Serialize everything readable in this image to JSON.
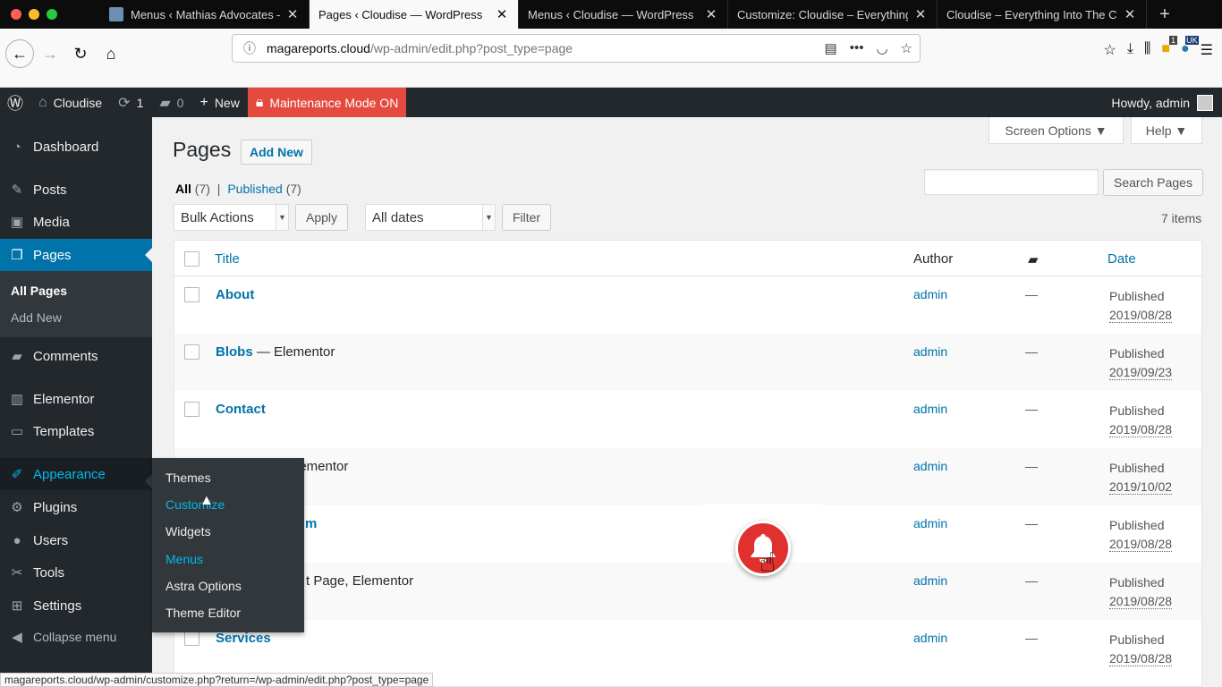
{
  "browser": {
    "tabs": [
      {
        "label": "Menus ‹ Mathias Advocates —",
        "active": false
      },
      {
        "label": "Pages ‹ Cloudise — WordPress",
        "active": true
      },
      {
        "label": "Menus ‹ Cloudise — WordPress",
        "active": false
      },
      {
        "label": "Customize: Cloudise – Everything I",
        "active": false
      },
      {
        "label": "Cloudise – Everything Into The Clo",
        "active": false
      }
    ],
    "url_host": "magareports.cloud",
    "url_path": "/wp-admin/edit.php?post_type=page",
    "badge_count": "1",
    "flag_badge": "UK",
    "status_url": "magareports.cloud/wp-admin/customize.php?return=/wp-admin/edit.php?post_type=page"
  },
  "adminbar": {
    "site_name": "Cloudise",
    "updates": "1",
    "comments": "0",
    "new_label": "New",
    "maintenance": "Maintenance Mode ON",
    "howdy": "Howdy, admin"
  },
  "sidebar": {
    "items": [
      {
        "label": "Dashboard",
        "icon": "dashboard-icon"
      },
      {
        "label": "Posts",
        "icon": "pin-icon"
      },
      {
        "label": "Media",
        "icon": "media-icon"
      },
      {
        "label": "Pages",
        "icon": "pages-icon"
      },
      {
        "label": "Comments",
        "icon": "comment-icon"
      },
      {
        "label": "Elementor",
        "icon": "elementor-icon"
      },
      {
        "label": "Templates",
        "icon": "folder-icon"
      },
      {
        "label": "Appearance",
        "icon": "brush-icon"
      },
      {
        "label": "Plugins",
        "icon": "plugin-icon"
      },
      {
        "label": "Users",
        "icon": "user-icon"
      },
      {
        "label": "Tools",
        "icon": "wrench-icon"
      },
      {
        "label": "Settings",
        "icon": "settings-icon"
      },
      {
        "label": "Collapse menu",
        "icon": "collapse-icon"
      }
    ],
    "pages_sub": [
      "All Pages",
      "Add New"
    ],
    "appearance_flyout": [
      "Themes",
      "Customize",
      "Widgets",
      "Menus",
      "Astra Options",
      "Theme Editor"
    ]
  },
  "main": {
    "title": "Pages",
    "add_new": "Add New",
    "screen_options": "Screen Options ▼",
    "help": "Help ▼",
    "filter_all": "All",
    "filter_all_count": "(7)",
    "filter_sep": "|",
    "filter_published": "Published",
    "filter_published_count": "(7)",
    "search_button": "Search Pages",
    "bulk_actions": "Bulk Actions",
    "apply": "Apply",
    "all_dates": "All dates",
    "filter": "Filter",
    "items_count": "7 items",
    "columns": {
      "title": "Title",
      "author": "Author",
      "date": "Date"
    },
    "rows": [
      {
        "title": "About",
        "suffix": "",
        "author": "admin",
        "comments": "—",
        "status": "Published",
        "date": "2019/08/28"
      },
      {
        "title": "Blobs",
        "suffix": " — Elementor",
        "author": "admin",
        "comments": "—",
        "status": "Published",
        "date": "2019/09/23"
      },
      {
        "title": "Contact",
        "suffix": "",
        "author": "admin",
        "comments": "—",
        "status": "Published",
        "date": "2019/08/28"
      },
      {
        "title": "",
        "suffix": "lementor",
        "author": "admin",
        "comments": "—",
        "status": "Published",
        "date": "2019/10/02"
      },
      {
        "title": "m",
        "suffix": "",
        "author": "admin",
        "comments": "—",
        "status": "Published",
        "date": "2019/08/28"
      },
      {
        "title": "",
        "suffix": "t Page, Elementor",
        "author": "admin",
        "comments": "—",
        "status": "Published",
        "date": "2019/08/28"
      },
      {
        "title": "Services",
        "suffix": "",
        "author": "admin",
        "comments": "—",
        "status": "Published",
        "date": "2019/08/28"
      }
    ]
  },
  "colors": {
    "wp_blue": "#0073aa",
    "admin_dark": "#23282d",
    "maintenance_red": "#e44a3e",
    "bell_red": "#e0312f",
    "hover_cyan": "#00b9eb"
  }
}
